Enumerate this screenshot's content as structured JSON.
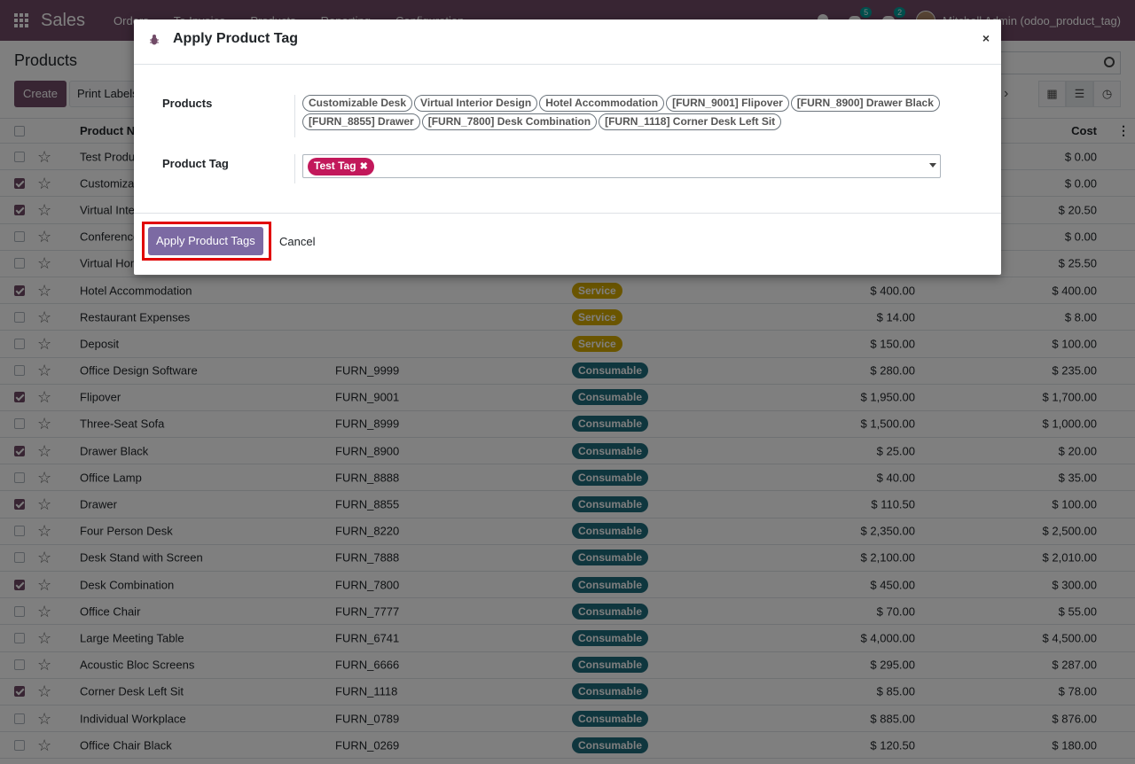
{
  "navbar": {
    "brand": "Sales",
    "menu": [
      "Orders",
      "To Invoice",
      "Products",
      "Reporting",
      "Configuration"
    ],
    "chat_badge": "5",
    "activity_badge": "2",
    "user": "Mitchell Admin (odoo_product_tag)"
  },
  "control": {
    "breadcrumb": "Products",
    "create_label": "Create",
    "print_label": "Print Labels",
    "pager_next": "›"
  },
  "table": {
    "headers": {
      "name": "Product Name",
      "cost": "Cost"
    },
    "rows": [
      {
        "checked": false,
        "name": "Test Product",
        "ref": "",
        "type": "",
        "price": "",
        "cost": "$ 0.00"
      },
      {
        "checked": true,
        "name": "Customizable Desk",
        "ref": "",
        "type": "",
        "price": "",
        "cost": "$ 0.00"
      },
      {
        "checked": true,
        "name": "Virtual Interior Design",
        "ref": "",
        "type": "",
        "price": "",
        "cost": "$ 20.50"
      },
      {
        "checked": false,
        "name": "Conference Chair",
        "ref": "",
        "type": "",
        "price": "",
        "cost": "$ 0.00"
      },
      {
        "checked": false,
        "name": "Virtual Home Staging",
        "ref": "",
        "type": "",
        "price": "",
        "cost": "$ 25.50"
      },
      {
        "checked": true,
        "name": "Hotel Accommodation",
        "ref": "",
        "type": "Service",
        "price": "$ 400.00",
        "cost": "$ 400.00"
      },
      {
        "checked": false,
        "name": "Restaurant Expenses",
        "ref": "",
        "type": "Service",
        "price": "$ 14.00",
        "cost": "$ 8.00"
      },
      {
        "checked": false,
        "name": "Deposit",
        "ref": "",
        "type": "Service",
        "price": "$ 150.00",
        "cost": "$ 100.00"
      },
      {
        "checked": false,
        "name": "Office Design Software",
        "ref": "FURN_9999",
        "type": "Consumable",
        "price": "$ 280.00",
        "cost": "$ 235.00"
      },
      {
        "checked": true,
        "name": "Flipover",
        "ref": "FURN_9001",
        "type": "Consumable",
        "price": "$ 1,950.00",
        "cost": "$ 1,700.00"
      },
      {
        "checked": false,
        "name": "Three-Seat Sofa",
        "ref": "FURN_8999",
        "type": "Consumable",
        "price": "$ 1,500.00",
        "cost": "$ 1,000.00"
      },
      {
        "checked": true,
        "name": "Drawer Black",
        "ref": "FURN_8900",
        "type": "Consumable",
        "price": "$ 25.00",
        "cost": "$ 20.00"
      },
      {
        "checked": false,
        "name": "Office Lamp",
        "ref": "FURN_8888",
        "type": "Consumable",
        "price": "$ 40.00",
        "cost": "$ 35.00"
      },
      {
        "checked": true,
        "name": "Drawer",
        "ref": "FURN_8855",
        "type": "Consumable",
        "price": "$ 110.50",
        "cost": "$ 100.00"
      },
      {
        "checked": false,
        "name": "Four Person Desk",
        "ref": "FURN_8220",
        "type": "Consumable",
        "price": "$ 2,350.00",
        "cost": "$ 2,500.00"
      },
      {
        "checked": false,
        "name": "Desk Stand with Screen",
        "ref": "FURN_7888",
        "type": "Consumable",
        "price": "$ 2,100.00",
        "cost": "$ 2,010.00"
      },
      {
        "checked": true,
        "name": "Desk Combination",
        "ref": "FURN_7800",
        "type": "Consumable",
        "price": "$ 450.00",
        "cost": "$ 300.00"
      },
      {
        "checked": false,
        "name": "Office Chair",
        "ref": "FURN_7777",
        "type": "Consumable",
        "price": "$ 70.00",
        "cost": "$ 55.00"
      },
      {
        "checked": false,
        "name": "Large Meeting Table",
        "ref": "FURN_6741",
        "type": "Consumable",
        "price": "$ 4,000.00",
        "cost": "$ 4,500.00"
      },
      {
        "checked": false,
        "name": "Acoustic Bloc Screens",
        "ref": "FURN_6666",
        "type": "Consumable",
        "price": "$ 295.00",
        "cost": "$ 287.00"
      },
      {
        "checked": true,
        "name": "Corner Desk Left Sit",
        "ref": "FURN_1118",
        "type": "Consumable",
        "price": "$ 85.00",
        "cost": "$ 78.00"
      },
      {
        "checked": false,
        "name": "Individual Workplace",
        "ref": "FURN_0789",
        "type": "Consumable",
        "price": "$ 885.00",
        "cost": "$ 876.00"
      },
      {
        "checked": false,
        "name": "Office Chair Black",
        "ref": "FURN_0269",
        "type": "Consumable",
        "price": "$ 120.50",
        "cost": "$ 180.00"
      }
    ]
  },
  "type_colors": {
    "Service": "#d4aa00",
    "Consumable": "#1f6c7d"
  },
  "modal": {
    "title": "Apply Product Tag",
    "close": "×",
    "products_label": "Products",
    "products": [
      "Customizable Desk",
      "Virtual Interior Design",
      "Hotel Accommodation",
      "[FURN_9001] Flipover",
      "[FURN_8900] Drawer Black",
      "[FURN_8855] Drawer",
      "[FURN_7800] Desk Combination",
      "[FURN_1118] Corner Desk Left Sit"
    ],
    "tag_label": "Product Tag",
    "selected_tag": "Test Tag",
    "tag_color": "#C2185B",
    "apply_label": "Apply Product Tags",
    "cancel_label": "Cancel"
  }
}
